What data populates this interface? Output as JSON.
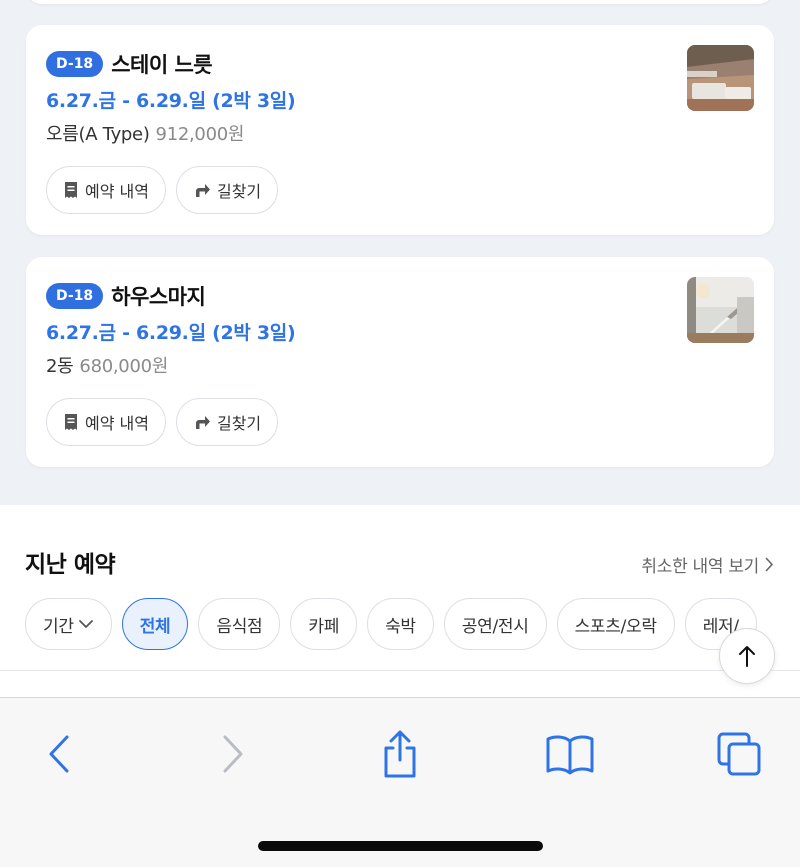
{
  "bookings": [
    {
      "dday": "D-18",
      "name": "스테이 느릇",
      "dates": "6.27.금 - 6.29.일 (2박 3일)",
      "room": "오름(A Type)",
      "price": "912,000원",
      "thumb_icon": "bedroom-photo",
      "details_label": "예약 내역",
      "directions_label": "길찾기"
    },
    {
      "dday": "D-18",
      "name": "하우스마지",
      "dates": "6.27.금 - 6.29.일 (2박 3일)",
      "room": "2동",
      "price": "680,000원",
      "thumb_icon": "staircase-interior-photo",
      "details_label": "예약 내역",
      "directions_label": "길찾기"
    }
  ],
  "past": {
    "title": "지난 예약",
    "cancelled_link": "취소한 내역 보기",
    "filters": {
      "period": "기간",
      "all": "전체",
      "restaurant": "음식점",
      "cafe": "카페",
      "lodging": "숙박",
      "performance": "공연/전시",
      "sports": "스포츠/오락",
      "leisure": "레저/"
    },
    "active_filter": "전체"
  },
  "colors": {
    "accent": "#2f74e6",
    "badge": "#2f6fe0",
    "background": "#eef1f6"
  },
  "toolbar_icons": [
    "back-icon",
    "forward-icon",
    "share-icon",
    "bookmarks-icon",
    "tabs-icon"
  ]
}
